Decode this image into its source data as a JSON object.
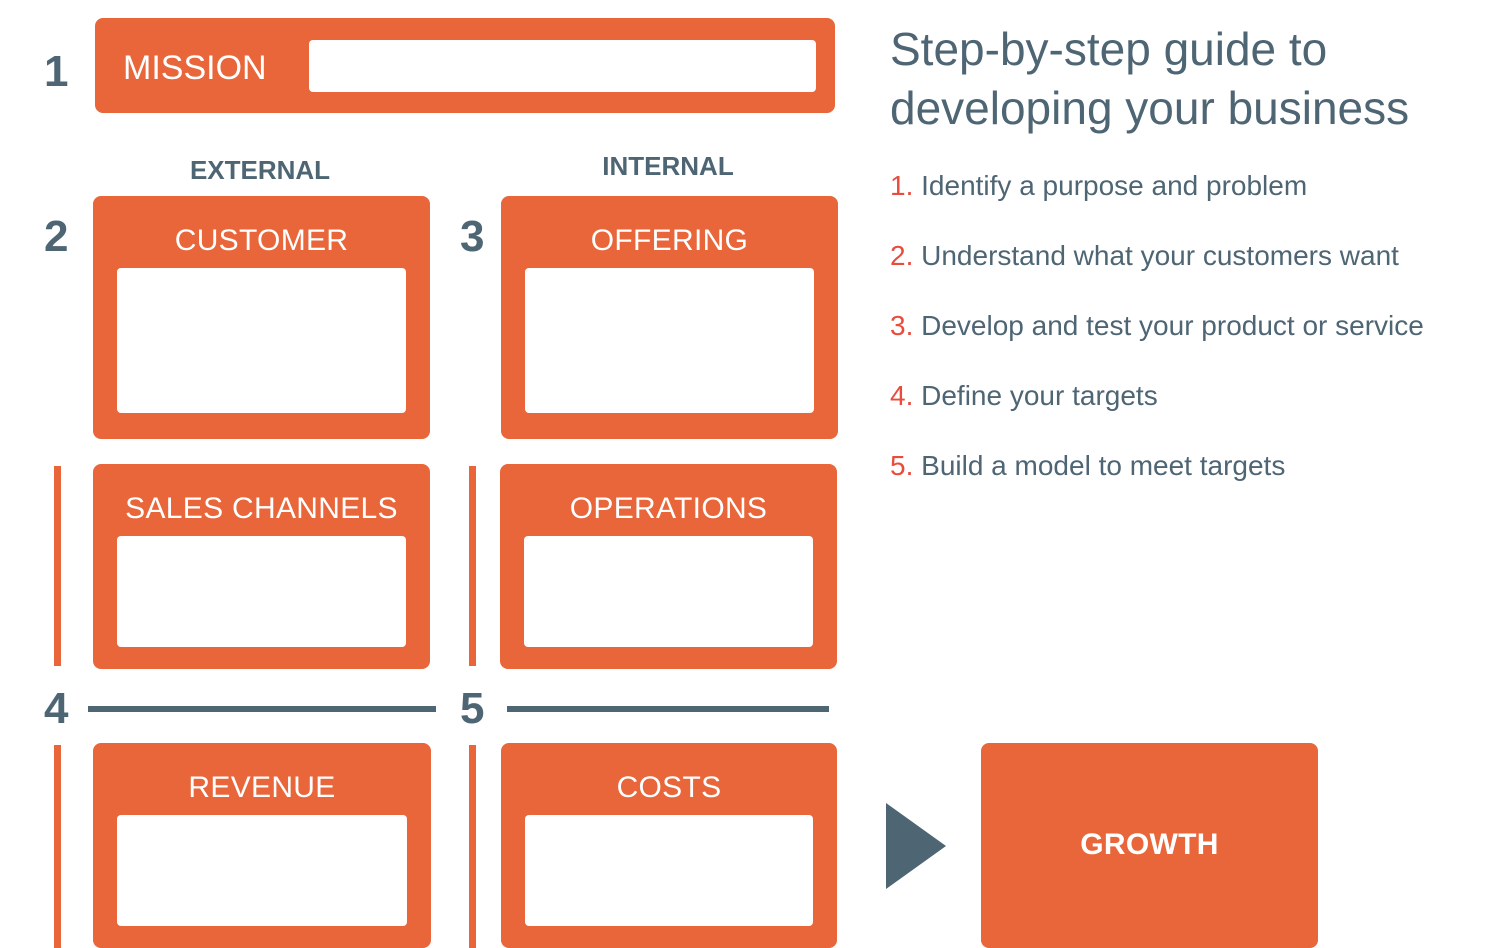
{
  "title": "Step-by-step guide to developing your business",
  "column_headings": {
    "external": "EXTERNAL",
    "internal": "INTERNAL"
  },
  "step_numbers": [
    "1",
    "2",
    "3",
    "4",
    "5"
  ],
  "boxes": {
    "mission": "MISSION",
    "customer": "CUSTOMER",
    "offering": "OFFERING",
    "sales_channels": "SALES CHANNELS",
    "operations": "OPERATIONS",
    "revenue": "REVENUE",
    "costs": "COSTS",
    "growth": "GROWTH"
  },
  "steps": [
    {
      "num": "1.",
      "text": "Identify a purpose and problem"
    },
    {
      "num": "2.",
      "text": "Understand what your customers want"
    },
    {
      "num": "3.",
      "text": "Develop and test your product or service"
    },
    {
      "num": "4.",
      "text": "Define your targets"
    },
    {
      "num": "5.",
      "text": "Build a model to meet targets"
    }
  ],
  "colors": {
    "accent": "#E8663A",
    "text": "#4E6574",
    "step_number": "#E84C3D"
  }
}
